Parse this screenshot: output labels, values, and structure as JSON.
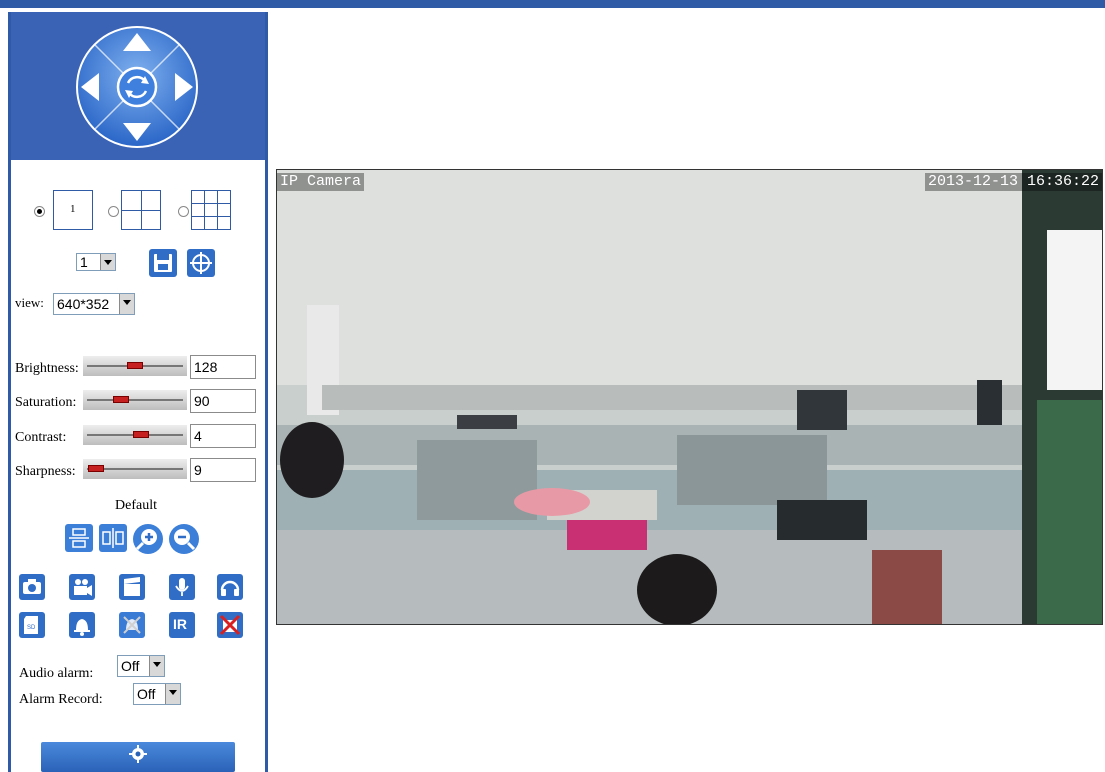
{
  "ptz": {
    "up_icon": "arrow-up-icon",
    "down_icon": "arrow-down-icon",
    "left_icon": "arrow-left-icon",
    "right_icon": "arrow-right-icon",
    "center_icon": "auto-rotate-icon"
  },
  "layout": {
    "options": [
      {
        "label": "1",
        "selected": true
      },
      {
        "label": "",
        "selected": false
      },
      {
        "label": "",
        "selected": false
      }
    ]
  },
  "preset": {
    "value": "1",
    "save_icon": "save-icon",
    "goto_icon": "crosshair-icon"
  },
  "view": {
    "label": "view:",
    "value": "640*352"
  },
  "image_settings": [
    {
      "label": "Brightness:",
      "value": "128"
    },
    {
      "label": "Saturation:",
      "value": "90"
    },
    {
      "label": "Contrast:",
      "value": "4"
    },
    {
      "label": "Sharpness:",
      "value": "9"
    }
  ],
  "default_label": "Default",
  "toolbar_row1": [
    "flip-vertical-icon",
    "mirror-icon",
    "zoom-in-icon",
    "zoom-out-icon"
  ],
  "toolbar_row2": [
    "snapshot-icon",
    "record-icon",
    "clip-icon",
    "microphone-icon",
    "headphones-icon"
  ],
  "toolbar_row3": [
    "sd-card-icon",
    "alarm-bell-icon",
    "alarm-off-icon",
    "ir-icon",
    "disable-icon"
  ],
  "ir_text": "IR",
  "audio_alarm": {
    "label": "Audio alarm:",
    "value": "Off"
  },
  "alarm_record": {
    "label": "Alarm Record:",
    "value": "Off"
  },
  "settings_icon": "gear-icon",
  "video": {
    "camera_name": "IP Camera",
    "timestamp": "2013-12-13 16:36:22"
  },
  "colors": {
    "accent": "#2f5aa5",
    "panel": "#3a62b5",
    "slider_thumb": "#c62020"
  }
}
